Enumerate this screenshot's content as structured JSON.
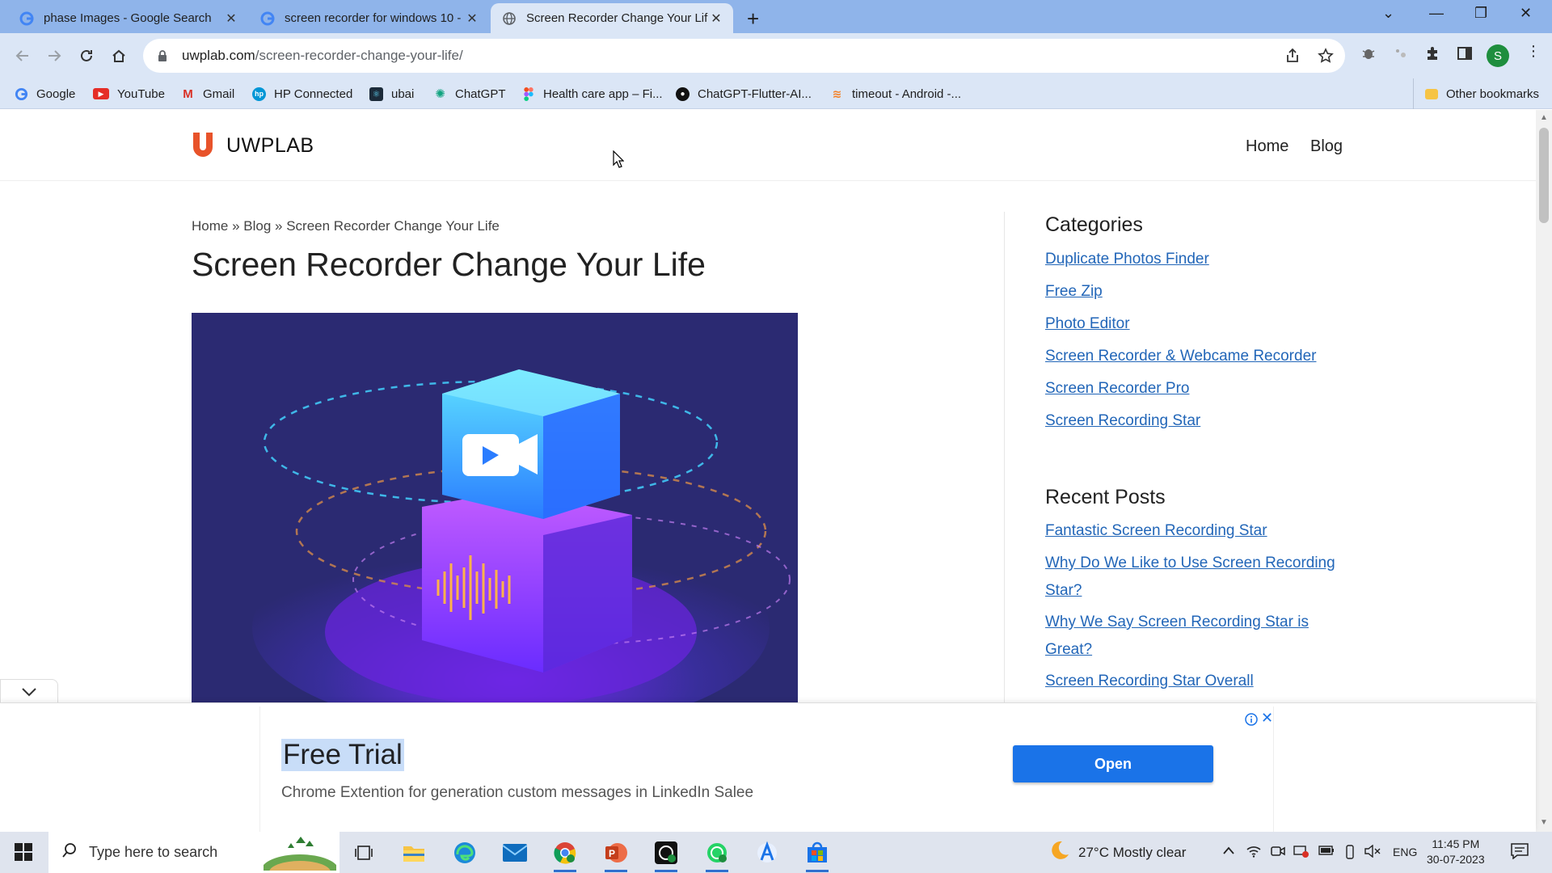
{
  "browser": {
    "tabs": [
      {
        "title": "phase Images - Google Search",
        "favicon": "google-icon",
        "active": false
      },
      {
        "title": "screen recorder for windows 10 -",
        "favicon": "google-icon",
        "active": false
      },
      {
        "title": "Screen Recorder Change Your Lif",
        "favicon": "globe-icon",
        "active": true
      }
    ],
    "new_tab_label": "+",
    "address": {
      "host": "uwplab.com",
      "path": "/screen-recorder-change-your-life/"
    },
    "profile_initial": "S",
    "bookmarks": [
      {
        "label": "Google",
        "icon": "google-icon"
      },
      {
        "label": "YouTube",
        "icon": "youtube-icon"
      },
      {
        "label": "Gmail",
        "icon": "gmail-icon"
      },
      {
        "label": "HP Connected",
        "icon": "hp-icon"
      },
      {
        "label": "ubai",
        "icon": "react-icon"
      },
      {
        "label": "ChatGPT",
        "icon": "chatgpt-icon"
      },
      {
        "label": "Health care app – Fi...",
        "icon": "figma-icon"
      },
      {
        "label": "ChatGPT-Flutter-AI...",
        "icon": "github-icon"
      },
      {
        "label": "timeout - Android -...",
        "icon": "stackoverflow-icon"
      }
    ],
    "other_bookmarks": "Other bookmarks"
  },
  "site": {
    "logo_text": "UWPLAB",
    "logo_letter": "U",
    "nav": [
      "Home",
      "Blog"
    ],
    "breadcrumb": {
      "home": "Home",
      "sep1": " » ",
      "blog": "Blog",
      "sep2": " » ",
      "current": "Screen Recorder Change Your Life"
    },
    "post_title": "Screen Recorder Change Your Life",
    "sidebar": {
      "categories_title": "Categories",
      "categories": [
        "Duplicate Photos Finder",
        "Free Zip",
        "Photo Editor",
        "Screen Recorder & Webcame Recorder",
        "Screen Recorder Pro",
        "Screen Recording Star"
      ],
      "recent_title": "Recent Posts",
      "recent": [
        "Fantastic Screen Recording Star",
        "Why Do We Like to Use Screen Recording Star?",
        "Why We Say Screen Recording Star is Great?",
        "Screen Recording Star Overall"
      ]
    },
    "colors": {
      "link": "#2266b8",
      "logo_accent": "#e8532a",
      "hero_bg": "#2b2a72"
    }
  },
  "ad": {
    "title": "Free Trial",
    "description": "Chrome Extention for generation custom messages in LinkedIn Salee",
    "button": "Open"
  },
  "taskbar": {
    "search_placeholder": "Type here to search",
    "weather": "27°C  Mostly clear",
    "language": "ENG",
    "time": "11:45 PM",
    "date": "30-07-2023",
    "apps": [
      "task-view-icon",
      "file-explorer-icon",
      "edge-icon",
      "mail-icon",
      "chrome-icon",
      "powerpoint-icon",
      "chatgpt-app-icon",
      "whatsapp-icon",
      "android-studio-icon",
      "store-icon"
    ]
  }
}
